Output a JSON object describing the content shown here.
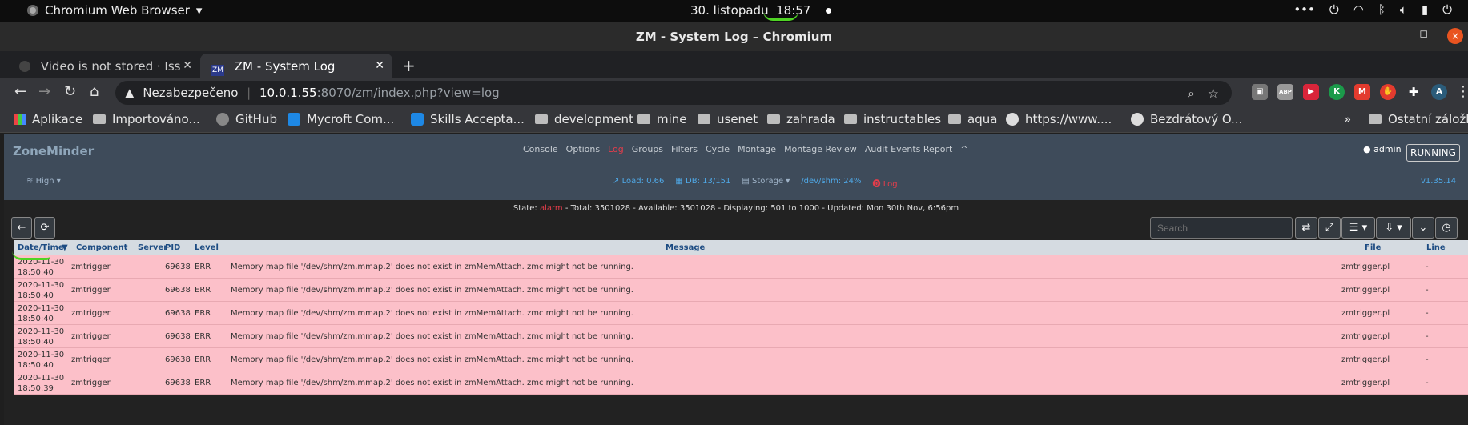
{
  "os": {
    "app_name": "Chromium Web Browser",
    "date": "30. listopadu",
    "time": "18:57",
    "tray": [
      "•••",
      "⏻",
      "wifi",
      "bt",
      "vol",
      "bat",
      "⚙"
    ]
  },
  "window": {
    "title": "ZM - System Log – Chromium",
    "min": "–",
    "max": "◻",
    "close": "×"
  },
  "tabs": [
    {
      "label": "Video is not stored · Issue",
      "close": "✕"
    },
    {
      "label": "ZM - System Log",
      "close": "✕"
    }
  ],
  "new_tab": "+",
  "omnibox": {
    "security": "Nezabezpečeno",
    "host": "10.0.1.55",
    "path": ":8070/zm/index.php?view=log"
  },
  "extensions": [
    "▣",
    "ABP",
    "▶",
    "K",
    "M",
    "✋",
    "✚",
    "A"
  ],
  "bookmarks": [
    {
      "label": "Aplikace"
    },
    {
      "label": "Importováno..."
    },
    {
      "label": "GitHub"
    },
    {
      "label": "Mycroft Com..."
    },
    {
      "label": "Skills Accepta..."
    },
    {
      "label": "development"
    },
    {
      "label": "mine"
    },
    {
      "label": "usenet"
    },
    {
      "label": "zahrada"
    },
    {
      "label": "instructables"
    },
    {
      "label": "aqua"
    },
    {
      "label": "https://www...."
    },
    {
      "label": "Bezdrátový O..."
    },
    {
      "label": "»"
    },
    {
      "label": "Ostatní záložky"
    }
  ],
  "zm": {
    "brand": "ZoneMinder",
    "menu": [
      "Console",
      "Options",
      "Log",
      "Groups",
      "Filters",
      "Cycle",
      "Montage",
      "Montage Review",
      "Audit Events Report",
      "^"
    ],
    "user": "admin",
    "running": "RUNNING",
    "bandwidth": "High",
    "load": "Load: 0.66",
    "db": "DB: 13/151",
    "storage": "Storage",
    "shm": "/dev/shm: 24%",
    "log_link": "Log",
    "version": "v1.35.14",
    "status": {
      "state_label": "State:",
      "state_value": "alarm",
      "rest": "- Total: 3501028 - Available: 3501028 - Displaying: 501 to 1000 - Updated: Mon 30th Nov, 6:56pm"
    },
    "search_placeholder": "Search",
    "back": "←",
    "refresh": "⟳"
  },
  "table": {
    "columns": [
      "Date/Time",
      "Component",
      "Server",
      "PID",
      "Level",
      "Message",
      "File",
      "Line"
    ],
    "rows": [
      {
        "date": "2020-11-30",
        "time": "18:50:40",
        "component": "zmtrigger",
        "server": "",
        "pid": "69638",
        "level": "ERR",
        "message": "Memory map file '/dev/shm/zm.mmap.2' does not exist in zmMemAttach. zmc might not be running.",
        "file": "zmtrigger.pl",
        "line": "-"
      },
      {
        "date": "2020-11-30",
        "time": "18:50:40",
        "component": "zmtrigger",
        "server": "",
        "pid": "69638",
        "level": "ERR",
        "message": "Memory map file '/dev/shm/zm.mmap.2' does not exist in zmMemAttach. zmc might not be running.",
        "file": "zmtrigger.pl",
        "line": "-"
      },
      {
        "date": "2020-11-30",
        "time": "18:50:40",
        "component": "zmtrigger",
        "server": "",
        "pid": "69638",
        "level": "ERR",
        "message": "Memory map file '/dev/shm/zm.mmap.2' does not exist in zmMemAttach. zmc might not be running.",
        "file": "zmtrigger.pl",
        "line": "-"
      },
      {
        "date": "2020-11-30",
        "time": "18:50:40",
        "component": "zmtrigger",
        "server": "",
        "pid": "69638",
        "level": "ERR",
        "message": "Memory map file '/dev/shm/zm.mmap.2' does not exist in zmMemAttach. zmc might not be running.",
        "file": "zmtrigger.pl",
        "line": "-"
      },
      {
        "date": "2020-11-30",
        "time": "18:50:40",
        "component": "zmtrigger",
        "server": "",
        "pid": "69638",
        "level": "ERR",
        "message": "Memory map file '/dev/shm/zm.mmap.2' does not exist in zmMemAttach. zmc might not be running.",
        "file": "zmtrigger.pl",
        "line": "-"
      },
      {
        "date": "2020-11-30",
        "time": "18:50:39",
        "component": "zmtrigger",
        "server": "",
        "pid": "69638",
        "level": "ERR",
        "message": "Memory map file '/dev/shm/zm.mmap.2' does not exist in zmMemAttach. zmc might not be running.",
        "file": "zmtrigger.pl",
        "line": "-"
      }
    ]
  },
  "colors": {
    "error_row": "#fcc0c9",
    "nav_bg": "#3e4b5a",
    "accent_red": "#e43d4b",
    "annotation_green": "#4fd324"
  }
}
